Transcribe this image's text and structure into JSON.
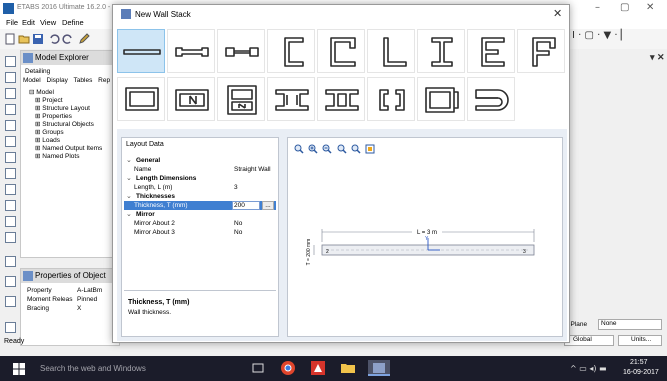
{
  "etabs": {
    "title": "ETABS 2016 Ultimate 16.2.0 - U",
    "menu": [
      "File",
      "Edit",
      "View",
      "Define"
    ],
    "model_explorer": {
      "title": "Model Explorer",
      "detailing": "Detailing",
      "tabs": [
        "Model",
        "Display",
        "Tables",
        "Rep"
      ],
      "tree_root": "Model",
      "tree_items": [
        "Project",
        "Structure Layout",
        "Properties",
        "Structural Objects",
        "Groups",
        "Loads",
        "Named Output Items",
        "Named Plots"
      ]
    },
    "properties_panel": {
      "title": "Properties of Object",
      "rows": [
        {
          "key": "Property",
          "value": "A-LatBm"
        },
        {
          "key": "Moment Releas",
          "value": "Pinned"
        },
        {
          "key": "Bracing",
          "value": "X"
        }
      ]
    },
    "status": "Ready",
    "plane_label": "ing Plane",
    "plane_value": "None",
    "coord_system": "Global",
    "units_label": "Units..."
  },
  "taskbar": {
    "search_placeholder": "Search the web and Windows",
    "time": "21:57",
    "date": "16-09-2017"
  },
  "dialog": {
    "title": "New Wall Stack",
    "selected_shape_index": 0,
    "layout_header": "Layout Data",
    "grid": [
      {
        "type": "cat",
        "label": "General"
      },
      {
        "type": "prop",
        "key": "Name",
        "value": "Straight Wall"
      },
      {
        "type": "cat",
        "label": "Length Dimensions"
      },
      {
        "type": "prop",
        "key": "Length, L (m)",
        "value": "3"
      },
      {
        "type": "cat",
        "label": "Thicknesses"
      },
      {
        "type": "edit",
        "key": "Thickness, T (mm)",
        "value": "200"
      },
      {
        "type": "cat",
        "label": "Mirror"
      },
      {
        "type": "prop",
        "key": "Mirror About 2",
        "value": "No"
      },
      {
        "type": "prop",
        "key": "Mirror About 3",
        "value": "No"
      }
    ],
    "ellipsis_label": "...",
    "description_title": "Thickness, T (mm)",
    "description_text": "Wall thickness.",
    "preview": {
      "length_label": "L = 3 m",
      "thickness_label": "T = 200 mm",
      "axis_2": "2",
      "axis_3": "3",
      "axis_y": "Y"
    }
  }
}
